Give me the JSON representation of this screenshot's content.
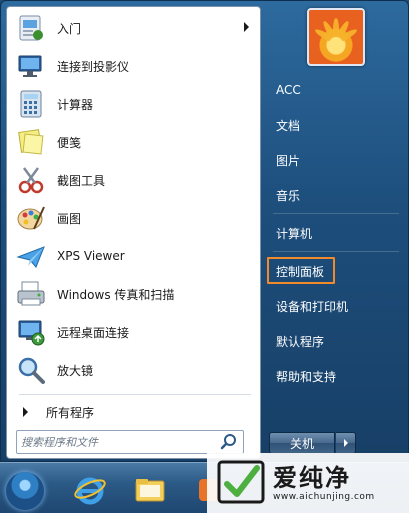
{
  "left_pane": {
    "programs": [
      {
        "label": "入门",
        "icon": "getting-started-icon",
        "has_submenu": true
      },
      {
        "label": "连接到投影仪",
        "icon": "projector-icon",
        "has_submenu": false
      },
      {
        "label": "计算器",
        "icon": "calculator-icon",
        "has_submenu": false
      },
      {
        "label": "便笺",
        "icon": "sticky-notes-icon",
        "has_submenu": false
      },
      {
        "label": "截图工具",
        "icon": "snipping-tool-icon",
        "has_submenu": false
      },
      {
        "label": "画图",
        "icon": "paint-icon",
        "has_submenu": false
      },
      {
        "label": "XPS Viewer",
        "icon": "xps-viewer-icon",
        "has_submenu": false
      },
      {
        "label": "Windows 传真和扫描",
        "icon": "fax-scan-icon",
        "has_submenu": false
      },
      {
        "label": "远程桌面连接",
        "icon": "remote-desktop-icon",
        "has_submenu": false
      },
      {
        "label": "放大镜",
        "icon": "magnifier-icon",
        "has_submenu": false
      }
    ],
    "all_programs": "所有程序",
    "search": {
      "placeholder": "搜索程序和文件"
    }
  },
  "right_pane": {
    "items": [
      {
        "label": "ACC"
      },
      {
        "label": "文档"
      },
      {
        "label": "图片"
      },
      {
        "label": "音乐"
      },
      {
        "label": "计算机"
      },
      {
        "label": "控制面板",
        "highlighted": true
      },
      {
        "label": "设备和打印机"
      },
      {
        "label": "默认程序"
      },
      {
        "label": "帮助和支持"
      }
    ],
    "shutdown_label": "关机"
  },
  "watermark": {
    "name": "爱纯净",
    "url": "www.aichunjing.com"
  },
  "colors": {
    "highlight_border": "#f08a2a",
    "menu_blue": "#1d4e7c",
    "watermark_green": "#4caf3f"
  }
}
